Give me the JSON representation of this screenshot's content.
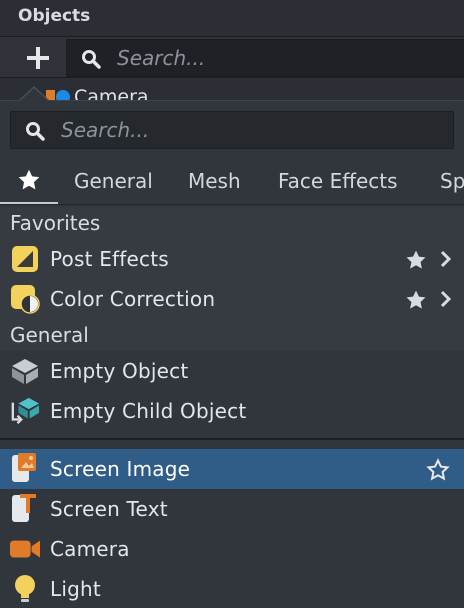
{
  "objects_panel": {
    "title": "Objects",
    "add_label": "+",
    "search_placeholder": "Search...",
    "partial_item_label": "Camera"
  },
  "popup": {
    "search_placeholder": "Search...",
    "tabs": [
      "General",
      "Mesh",
      "Face Effects",
      "Sp"
    ],
    "sections": {
      "favorites": "Favorites",
      "general": "General"
    },
    "favorites": [
      {
        "label": "Post Effects",
        "icon": "post-effects-icon"
      },
      {
        "label": "Color Correction",
        "icon": "color-correction-icon"
      }
    ],
    "general_items": [
      {
        "label": "Empty Object",
        "icon": "empty-object-icon"
      },
      {
        "label": "Empty Child Object",
        "icon": "empty-child-object-icon"
      }
    ],
    "items": [
      {
        "label": "Screen Image",
        "icon": "screen-image-icon",
        "selected": true
      },
      {
        "label": "Screen Text",
        "icon": "screen-text-icon"
      },
      {
        "label": "Camera",
        "icon": "camera-icon"
      },
      {
        "label": "Light",
        "icon": "light-icon"
      }
    ]
  },
  "colors": {
    "accent_selected": "#2f5d88",
    "icon_yellow": "#f2d15c",
    "icon_orange": "#e07b2a",
    "panel_bg": "#31353c"
  }
}
